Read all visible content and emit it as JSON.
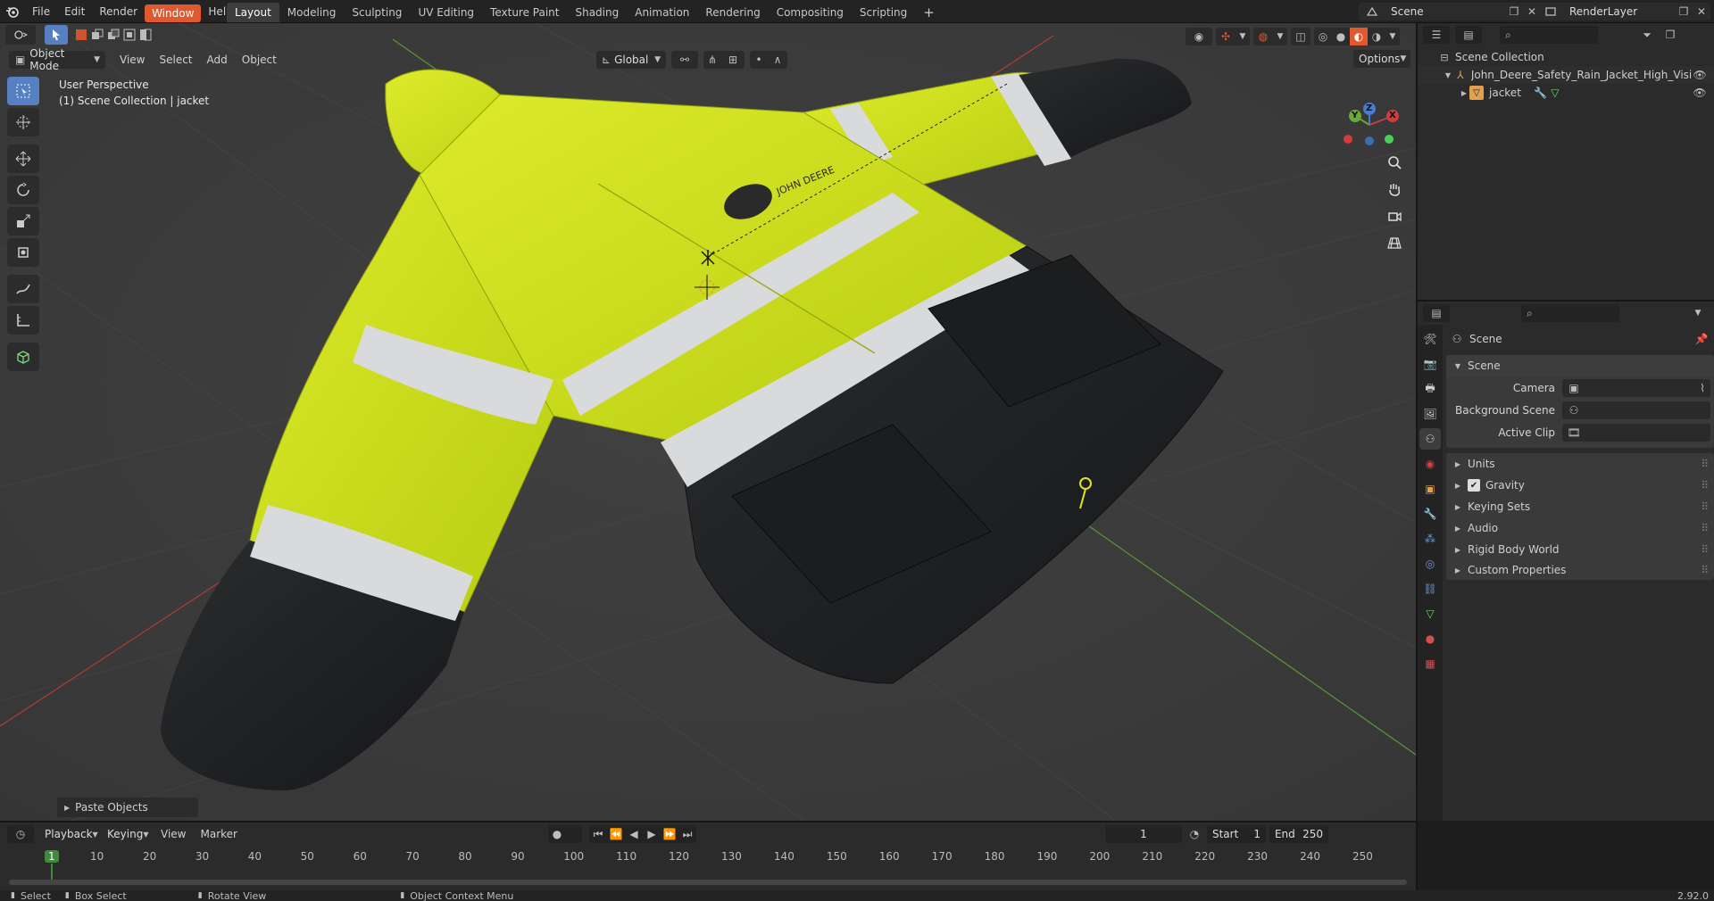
{
  "topbar": {
    "menus": [
      "File",
      "Edit",
      "Render",
      "Window",
      "Help"
    ],
    "active_menu": "Window",
    "workspaces": [
      "Layout",
      "Modeling",
      "Sculpting",
      "UV Editing",
      "Texture Paint",
      "Shading",
      "Animation",
      "Rendering",
      "Compositing",
      "Scripting"
    ],
    "active_workspace": "Layout",
    "add_tab": "+",
    "scene_name": "Scene",
    "view_layer": "RenderLayer"
  },
  "viewport": {
    "mode": "Object Mode",
    "menus": [
      "View",
      "Select",
      "Add",
      "Object"
    ],
    "transform_orientation": "Global",
    "options": "Options",
    "overlay_title": "User Perspective",
    "overlay_subtitle": "(1) Scene Collection | jacket",
    "last_op": "Paste Objects",
    "logo_text": "JOHN DEERE",
    "gizmo": {
      "x": "X",
      "y": "Y",
      "z": "Z"
    }
  },
  "outliner": {
    "search_placeholder": "",
    "root": "Scene Collection",
    "items": [
      {
        "name": "John_Deere_Safety_Rain_Jacket_High_Visibil",
        "depth": 1
      },
      {
        "name": "jacket",
        "depth": 2
      }
    ]
  },
  "properties": {
    "header": "Scene",
    "section": "Scene",
    "fields": [
      {
        "label": "Camera",
        "value": ""
      },
      {
        "label": "Background Scene",
        "value": ""
      },
      {
        "label": "Active Clip",
        "value": ""
      }
    ],
    "panels": [
      "Units",
      "Gravity",
      "Keying Sets",
      "Audio",
      "Rigid Body World",
      "Custom Properties"
    ],
    "gravity_checked": true
  },
  "timeline": {
    "menus": [
      "Playback",
      "Keying",
      "View",
      "Marker"
    ],
    "current_frame": "1",
    "start_label": "Start",
    "start": "1",
    "end_label": "End",
    "end": "250",
    "ruler": [
      "1",
      "10",
      "20",
      "30",
      "40",
      "50",
      "60",
      "70",
      "80",
      "90",
      "100",
      "110",
      "120",
      "130",
      "140",
      "150",
      "160",
      "170",
      "180",
      "190",
      "200",
      "210",
      "220",
      "230",
      "240",
      "250"
    ]
  },
  "status": {
    "items": [
      "Select",
      "Box Select",
      "Rotate View",
      "Object Context Menu"
    ],
    "version": "2.92.0"
  },
  "colors": {
    "accent": "#e0582e",
    "hivis": "#c8dc18",
    "reflective": "#d8dadc",
    "dark": "#1f2123",
    "grid_x": "#b13a3a",
    "grid_y": "#5a9a2e"
  }
}
